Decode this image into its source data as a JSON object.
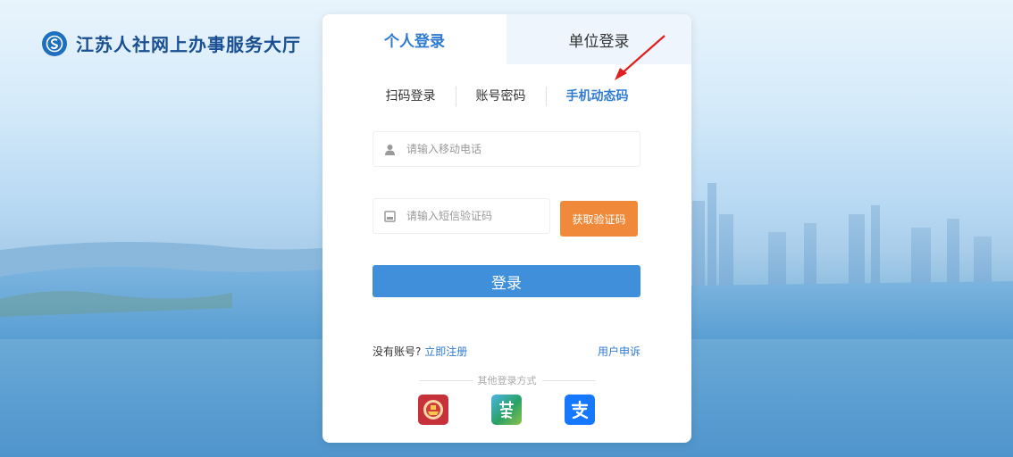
{
  "app": {
    "title": "江苏人社网上办事服务大厅"
  },
  "tabs": {
    "personal": "个人登录",
    "unit": "单位登录"
  },
  "subtabs": {
    "scan": "扫码登录",
    "account": "账号密码",
    "phone": "手机动态码"
  },
  "form": {
    "phone_placeholder": "请输入移动电话",
    "sms_placeholder": "请输入短信验证码",
    "sms_button": "获取验证码",
    "login_button": "登录"
  },
  "footer": {
    "no_account": "没有账号?",
    "register": "立即注册",
    "appeal": "用户申诉",
    "other_methods": "其他登录方式",
    "other_icons": [
      "national-emblem-icon",
      "su-app-icon",
      "alipay-icon"
    ]
  },
  "colors": {
    "accent": "#2f7bd1",
    "sms_button": "#f08a3a",
    "login_button": "#3f8fda",
    "arrow": "#e02020"
  }
}
